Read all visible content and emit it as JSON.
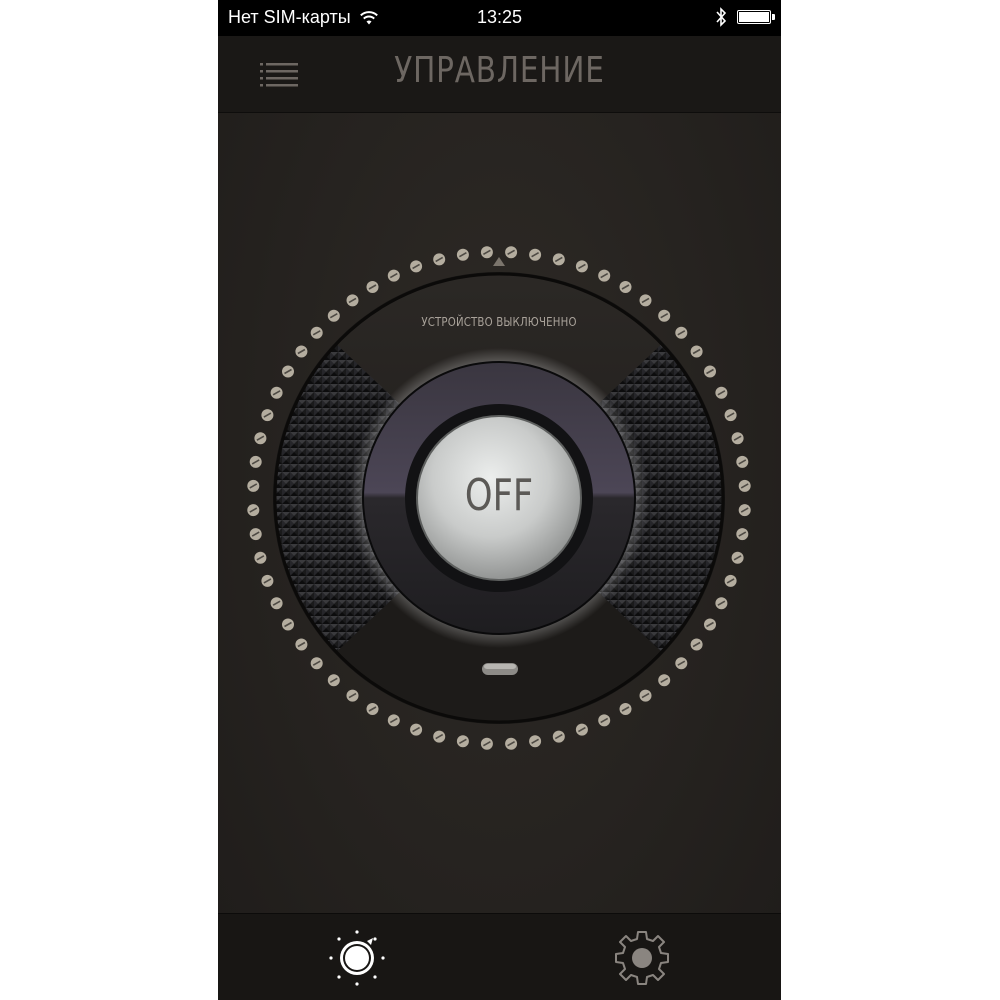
{
  "status_bar": {
    "carrier": "Нет SIM-карты",
    "time": "13:25",
    "icons": [
      "wifi-icon",
      "bluetooth-icon",
      "battery-icon"
    ]
  },
  "nav": {
    "title": "УПРАВЛЕНИЕ",
    "menu_icon": "list-menu-icon"
  },
  "dial": {
    "status_text": "УСТРОЙСТВО ВЫКЛЮЧЕННО",
    "power_label": "OFF",
    "tick_count": 64
  },
  "tabs": [
    {
      "icon": "lamp-control-icon",
      "selected": true
    },
    {
      "icon": "gear-icon",
      "selected": false
    }
  ],
  "colors": {
    "background": "#25221f",
    "bar": "#1a1816",
    "title": "#6d6762",
    "tick": "#b4ad9f",
    "knob": "#cfd1d0"
  }
}
